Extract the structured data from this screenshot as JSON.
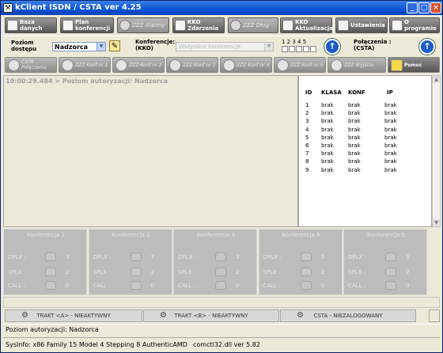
{
  "window": {
    "title": "kClient ISDN / CSTA ver  4.25",
    "min": "_",
    "max": "□",
    "close": "×"
  },
  "toolbar": [
    {
      "label": "Baza danych",
      "enabled": true
    },
    {
      "label": "Plan konferencji",
      "enabled": true
    },
    {
      "label": "ZZZ Alarmy",
      "enabled": false
    },
    {
      "label": "KKO Zdarzenia",
      "enabled": true
    },
    {
      "label": "ZZZ Dług",
      "enabled": false
    },
    {
      "label": "KKO Aktualizacja",
      "enabled": true
    },
    {
      "label": "Ustawienia",
      "enabled": true
    },
    {
      "label": "O programie",
      "enabled": true
    }
  ],
  "access": {
    "label": "Poziom dostępu",
    "value": "Nadzorca"
  },
  "conference": {
    "label": "Konferencje: (KKO)",
    "value": "Wszystkie konferencje",
    "numbers": "1 2 3 4 5"
  },
  "connections": {
    "label": "Połączenia : (CSTA)"
  },
  "tabs": [
    {
      "label": "CSTA Połączenia"
    },
    {
      "label": "ZZZ Konf nr 1"
    },
    {
      "label": "ZZZ Konf nr 2"
    },
    {
      "label": "ZZZ Konf nr 3"
    },
    {
      "label": "ZZZ Konf nr 4"
    },
    {
      "label": "ZZZ Konf nr 5"
    },
    {
      "label": "ZZZ Wyjście"
    },
    {
      "label": "Pomoc"
    }
  ],
  "log": {
    "line": "10:00:29.484 > Poziom autoryzacji: Nadzorca"
  },
  "id_table": {
    "headers": [
      "ID",
      "KLASA",
      "KONF",
      "IP"
    ],
    "rows": [
      [
        "1",
        "brak",
        "brak",
        "brak"
      ],
      [
        "2",
        "brak",
        "brak",
        "brak"
      ],
      [
        "3",
        "brak",
        "brak",
        "brak"
      ],
      [
        "4",
        "brak",
        "brak",
        "brak"
      ],
      [
        "5",
        "brak",
        "brak",
        "brak"
      ],
      [
        "6",
        "brak",
        "brak",
        "brak"
      ],
      [
        "7",
        "brak",
        "brak",
        "brak"
      ],
      [
        "8",
        "brak",
        "brak",
        "brak"
      ],
      [
        "9",
        "brak",
        "brak",
        "brak"
      ]
    ]
  },
  "conferences": [
    {
      "title": "Konferencja 1",
      "dplx": "3",
      "splx": "2",
      "call": "0"
    },
    {
      "title": "Konferencja 2",
      "dplx": "3",
      "splx": "2",
      "call": "0"
    },
    {
      "title": "Konferencja 3",
      "dplx": "3",
      "splx": "2",
      "call": "0"
    },
    {
      "title": "Konferencja 4",
      "dplx": "3",
      "splx": "2",
      "call": "0"
    },
    {
      "title": "Konferencja 5",
      "dplx": "3",
      "splx": "2",
      "call": "0"
    }
  ],
  "conf_labels": {
    "dplx": "DPLX :",
    "splx": "SPLX :",
    "call": "CALL :"
  },
  "trakt": [
    {
      "label": "TRAKT <A> - NIEAKTYWNY"
    },
    {
      "label": "TRAKT <B> - NIEAKTYWNY"
    },
    {
      "label": "CSTA - NIEZALOGOWANY"
    }
  ],
  "status": {
    "auth": "Poziom autoryzacji: Nadzorca",
    "sysinfo": "SysInfo: x86 Family 15 Model 4 Stepping 8 AuthenticAMD",
    "dll": "comctl32.dll ver 5.82"
  }
}
